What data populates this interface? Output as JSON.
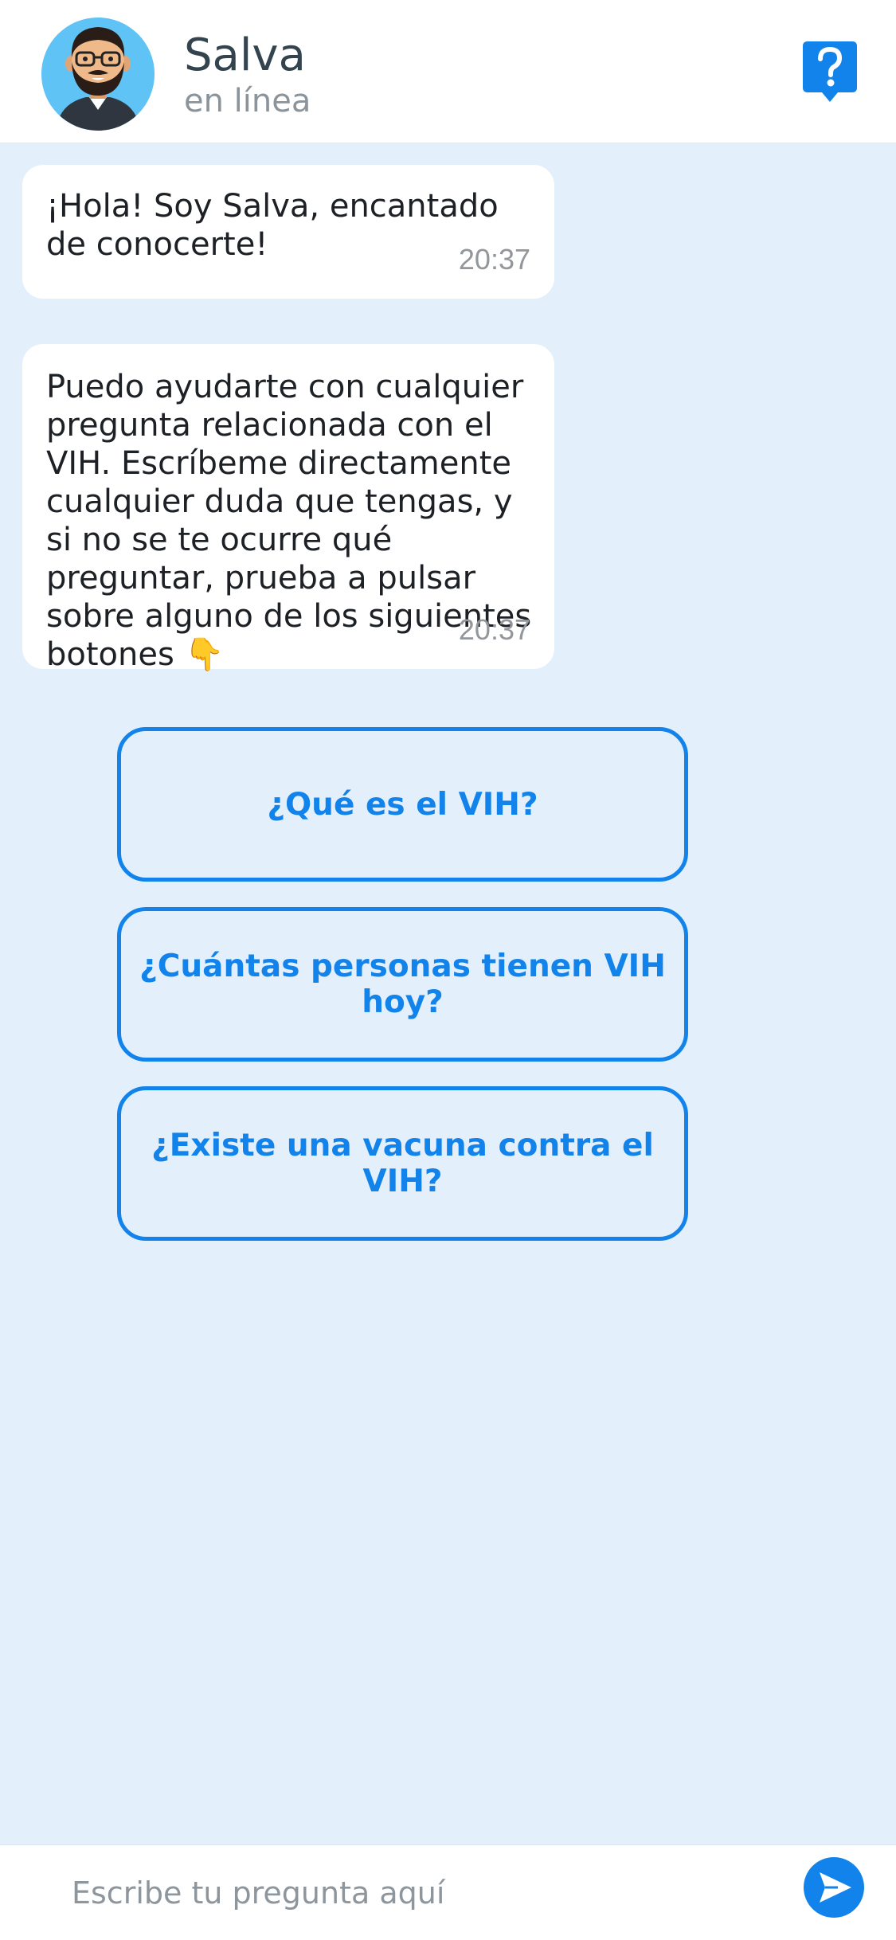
{
  "header": {
    "contact_name": "Salva",
    "contact_status": "en línea",
    "help_icon": "question-bubble-icon",
    "avatar_icon": "avatar-icon"
  },
  "messages": [
    {
      "text": "¡Hola! Soy Salva, encantado de conocerte!",
      "time": "20:37"
    },
    {
      "text": "Puedo ayudarte con cualquier pregunta relacionada con el VIH. Escríbeme directamente cualquier duda que tengas, y si no se te ocurre qué preguntar, prueba a pulsar sobre alguno de los siguientes botones",
      "emoji": "👇",
      "time": "20:37"
    }
  ],
  "quick_replies": [
    "¿Qué es el VIH?",
    "¿Cuántas personas tienen VIH hoy?",
    "¿Existe una vacuna contra el VIH?"
  ],
  "composer": {
    "placeholder": "Escribe tu pregunta aquí",
    "send_icon": "send-icon"
  },
  "colors": {
    "accent": "#1283ea",
    "background": "#e3f0fc",
    "bubble": "#ffffff",
    "avatar_bg": "#60c3f5"
  }
}
